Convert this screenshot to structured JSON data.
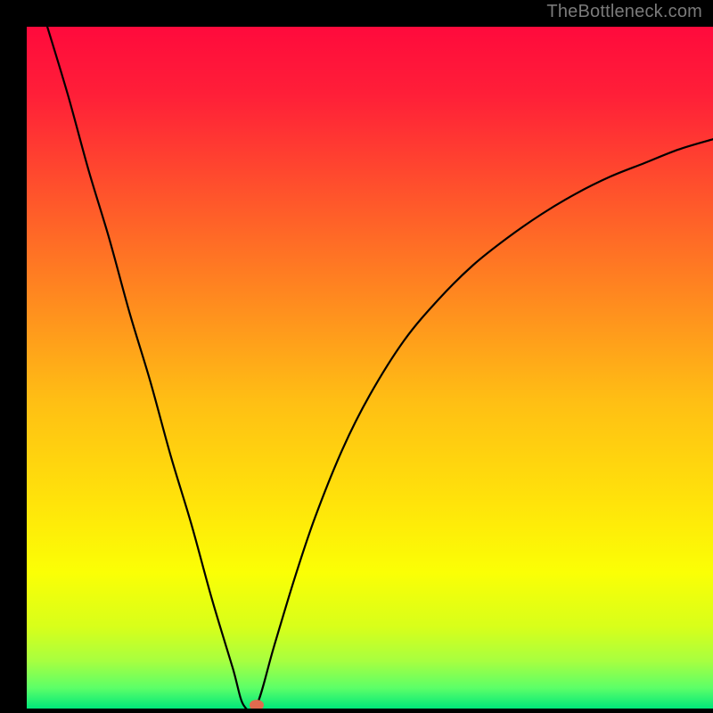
{
  "watermark": "TheBottleneck.com",
  "plot": {
    "outer_w": 800,
    "outer_h": 800,
    "inner_left": 30,
    "inner_top": 30,
    "inner_w": 770,
    "inner_h": 765
  },
  "gradient": {
    "stops": [
      {
        "offset": 0.0,
        "color": "#ff0a3c"
      },
      {
        "offset": 0.1,
        "color": "#ff1f38"
      },
      {
        "offset": 0.25,
        "color": "#ff552b"
      },
      {
        "offset": 0.4,
        "color": "#ff8a1f"
      },
      {
        "offset": 0.55,
        "color": "#ffbf14"
      },
      {
        "offset": 0.7,
        "color": "#ffe40a"
      },
      {
        "offset": 0.8,
        "color": "#fbff05"
      },
      {
        "offset": 0.88,
        "color": "#d8ff1a"
      },
      {
        "offset": 0.93,
        "color": "#a8ff40"
      },
      {
        "offset": 0.97,
        "color": "#5cff68"
      },
      {
        "offset": 1.0,
        "color": "#00e87a"
      }
    ]
  },
  "marker": {
    "x_frac": 0.335,
    "y_frac": 0.995,
    "rx": 8,
    "ry": 6,
    "color": "#e06a4f"
  },
  "chart_data": {
    "type": "line",
    "title": "",
    "xlabel": "",
    "ylabel": "",
    "xlim": [
      0,
      100
    ],
    "ylim": [
      0,
      100
    ],
    "grid": false,
    "series": [
      {
        "name": "bottleneck-curve",
        "color": "#000000",
        "x": [
          3,
          6,
          9,
          12,
          15,
          18,
          21,
          24,
          27,
          30,
          31.6,
          33.5,
          36,
          39,
          42,
          46,
          50,
          55,
          60,
          65,
          70,
          75,
          80,
          85,
          90,
          95,
          100
        ],
        "y": [
          100,
          90,
          79,
          69,
          58,
          48,
          37,
          27,
          16,
          6,
          0.5,
          0.5,
          9,
          19,
          28,
          38,
          46,
          54,
          60,
          65,
          69,
          72.5,
          75.5,
          78,
          80,
          82,
          83.5
        ]
      }
    ],
    "annotations": [
      {
        "name": "optimal-point",
        "x": 33.5,
        "y": 0.5
      }
    ]
  }
}
